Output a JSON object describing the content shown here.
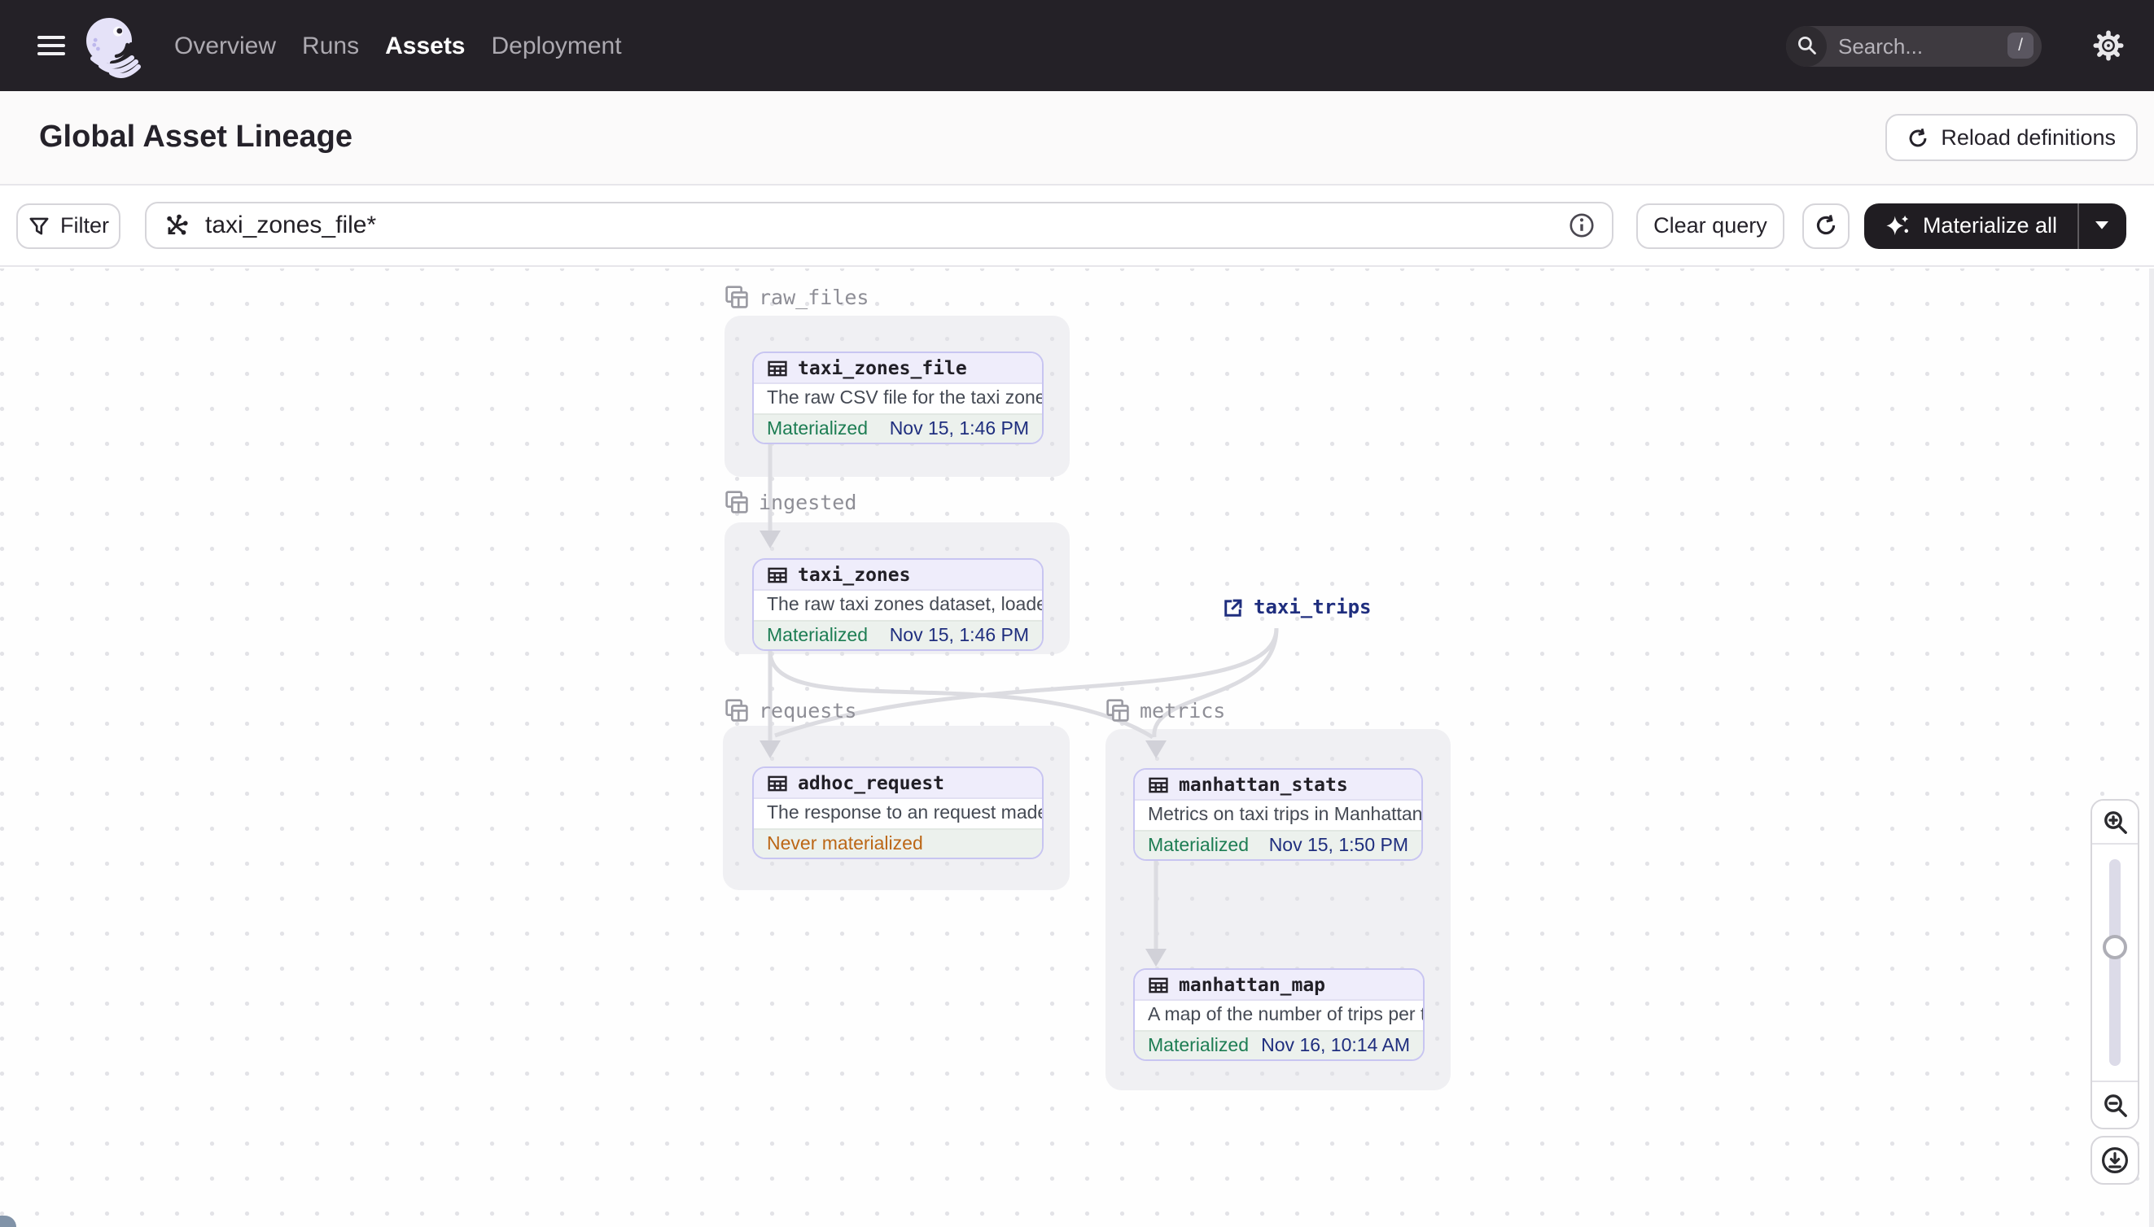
{
  "nav": {
    "items": [
      {
        "label": "Overview",
        "active": false
      },
      {
        "label": "Runs",
        "active": false
      },
      {
        "label": "Assets",
        "active": true
      },
      {
        "label": "Deployment",
        "active": false
      }
    ],
    "search": {
      "placeholder": "Search...",
      "shortcut_key": "/"
    }
  },
  "header": {
    "title": "Global Asset Lineage",
    "reload_button": "Reload definitions"
  },
  "toolbar": {
    "filter_button": "Filter",
    "query": {
      "value": "taxi_zones_file*"
    },
    "clear_button": "Clear query",
    "materialize_button": "Materialize all"
  },
  "lineage": {
    "groups": [
      {
        "id": "raw_files",
        "label": "raw_files"
      },
      {
        "id": "ingested",
        "label": "ingested"
      },
      {
        "id": "requests",
        "label": "requests"
      },
      {
        "id": "metrics",
        "label": "metrics"
      }
    ],
    "nodes": [
      {
        "id": "taxi_zones_file",
        "group": "raw_files",
        "title": "taxi_zones_file",
        "description": "The raw CSV file for the taxi zones dat...",
        "status": "Materialized",
        "status_type": "materialized",
        "timestamp": "Nov 15, 1:46 PM"
      },
      {
        "id": "taxi_zones",
        "group": "ingested",
        "title": "taxi_zones",
        "description": "The raw taxi zones dataset, loaded int...",
        "status": "Materialized",
        "status_type": "materialized",
        "timestamp": "Nov 15, 1:46 PM"
      },
      {
        "id": "adhoc_request",
        "group": "requests",
        "title": "adhoc_request",
        "description": "The response to an request made in th...",
        "status": "Never materialized",
        "status_type": "never",
        "timestamp": ""
      },
      {
        "id": "manhattan_stats",
        "group": "metrics",
        "title": "manhattan_stats",
        "description": "Metrics on taxi trips in Manhattan",
        "status": "Materialized",
        "status_type": "materialized",
        "timestamp": "Nov 15, 1:50 PM"
      },
      {
        "id": "manhattan_map",
        "group": "metrics",
        "title": "manhattan_map",
        "description": "A map of the number of trips per taxi z...",
        "status": "Materialized",
        "status_type": "materialized",
        "timestamp": "Nov 16, 10:14 AM"
      }
    ],
    "external_assets": [
      {
        "id": "taxi_trips",
        "label": "taxi_trips"
      }
    ],
    "edges": [
      {
        "from": "taxi_zones_file",
        "to": "taxi_zones"
      },
      {
        "from": "taxi_zones",
        "to": "adhoc_request"
      },
      {
        "from": "taxi_zones",
        "to": "manhattan_stats"
      },
      {
        "from": "taxi_trips",
        "to": "adhoc_request"
      },
      {
        "from": "taxi_trips",
        "to": "manhattan_stats"
      },
      {
        "from": "manhattan_stats",
        "to": "manhattan_map"
      }
    ]
  },
  "colors": {
    "nav_bg": "#242127",
    "node_border_purple": "#C8C5F1",
    "node_header_lavender": "#EFEDFB",
    "materialized_green": "#1D7D53",
    "never_materialized_orange": "#BC6717",
    "timestamp_navy": "#1F2E7E",
    "edge_gray": "#DCDCE1"
  }
}
